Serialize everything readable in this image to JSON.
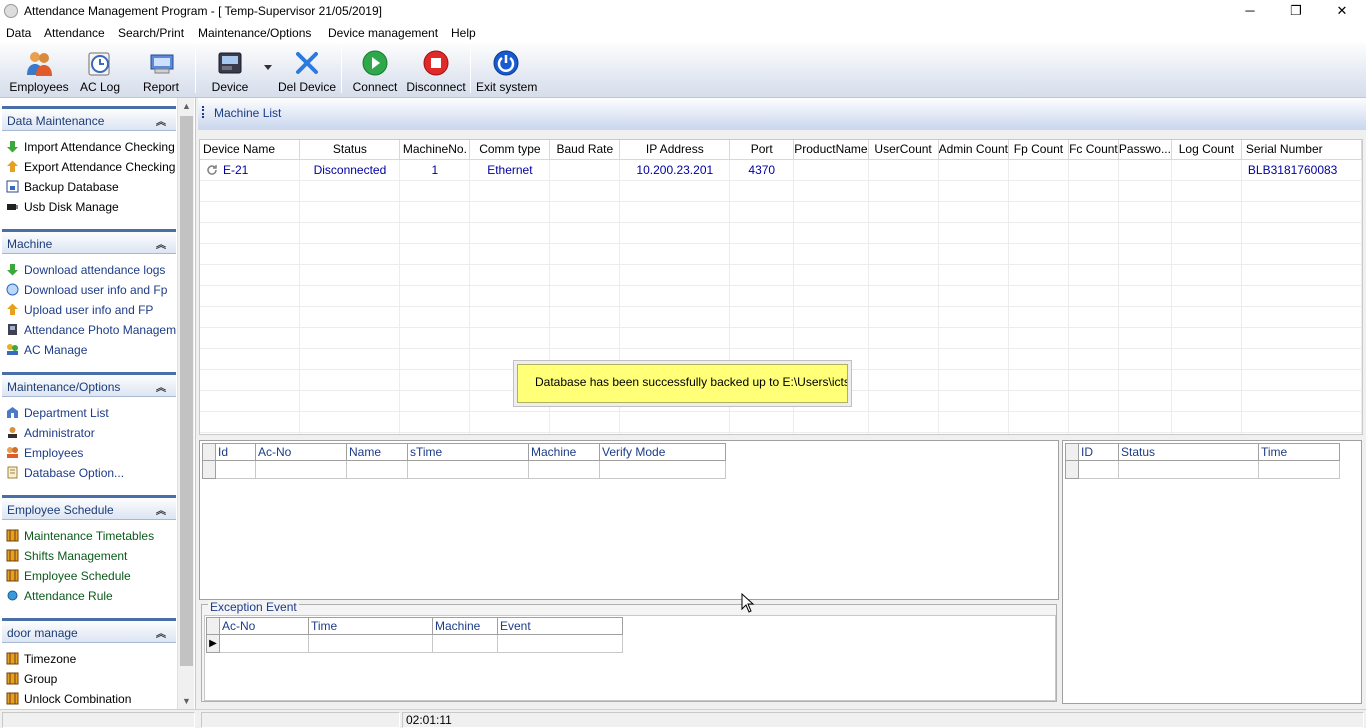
{
  "window": {
    "title": "Attendance Management Program - [ Temp-Supervisor 21/05/2019]",
    "minimize": "─",
    "restore": "❐",
    "close": "✕"
  },
  "menu": [
    "Data",
    "Attendance",
    "Search/Print",
    "Maintenance/Options",
    "Device management",
    "Help"
  ],
  "toolbar": {
    "employees": "Employees",
    "aclog": "AC Log",
    "report": "Report",
    "device": "Device",
    "deldevice": "Del Device",
    "connect": "Connect",
    "disconnect": "Disconnect",
    "exit": "Exit system"
  },
  "sidebar": {
    "groups": [
      {
        "title": "Data Maintenance",
        "items": [
          "Import Attendance Checking ...",
          "Export Attendance Checking ...",
          "Backup Database",
          "Usb Disk Manage"
        ]
      },
      {
        "title": "Machine",
        "items": [
          "Download attendance logs",
          "Download user info and Fp",
          "Upload user info and FP",
          "Attendance Photo Managem...",
          "AC Manage"
        ]
      },
      {
        "title": "Maintenance/Options",
        "items": [
          "Department List",
          "Administrator",
          "Employees",
          "Database Option..."
        ]
      },
      {
        "title": "Employee Schedule",
        "items": [
          "Maintenance Timetables",
          "Shifts Management",
          "Employee Schedule",
          "Attendance Rule"
        ]
      },
      {
        "title": "door manage",
        "items": [
          "Timezone",
          "Group",
          "Unlock Combination"
        ]
      }
    ],
    "collapse_glyph": "︽"
  },
  "machine_list": {
    "title": "Machine List",
    "columns": [
      "Device Name",
      "Status",
      "MachineNo.",
      "Comm type",
      "Baud Rate",
      "IP Address",
      "Port",
      "ProductName",
      "UserCount",
      "Admin Count",
      "Fp Count",
      "Fc Count",
      "Passwo...",
      "Log Count",
      "Serial Number"
    ],
    "rows": [
      [
        "E-21",
        "Disconnected",
        "1",
        "Ethernet",
        "",
        "10.200.23.201",
        "4370",
        "",
        "",
        "",
        "",
        "",
        "",
        "",
        "BLB3181760083"
      ]
    ]
  },
  "toast": {
    "message": "Database has been successfully backed up to E:\\Users\\ictsmart\\D"
  },
  "log_grid": {
    "columns": [
      "Id",
      "Ac-No",
      "Name",
      "sTime",
      "Machine",
      "Verify Mode"
    ]
  },
  "right_grid": {
    "columns": [
      "ID",
      "Status",
      "Time"
    ]
  },
  "exception": {
    "title": "Exception Event",
    "columns": [
      "Ac-No",
      "Time",
      "Machine",
      "Event"
    ],
    "row_marker": "▶"
  },
  "statusbar": {
    "time": "02:01:11"
  }
}
